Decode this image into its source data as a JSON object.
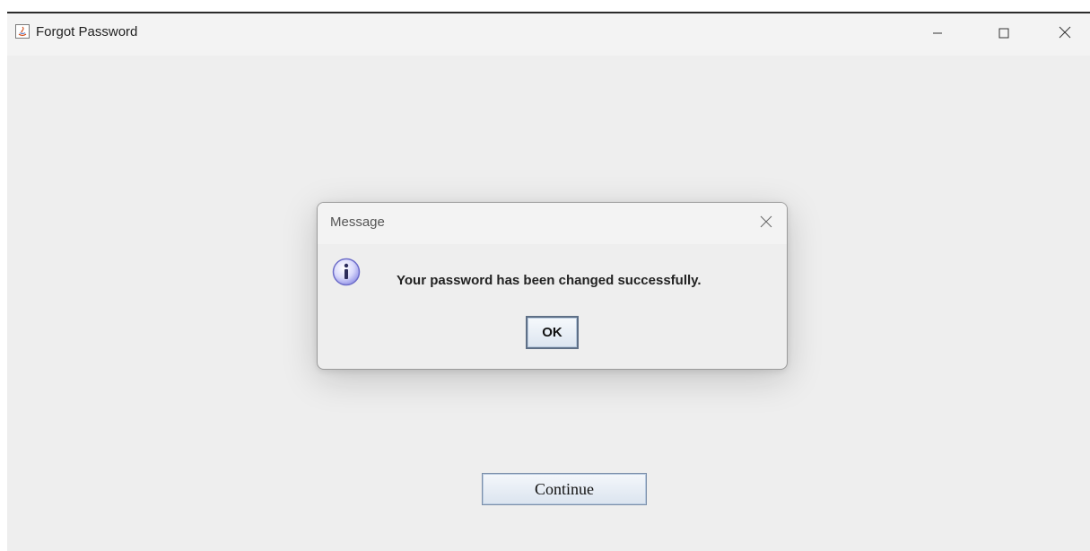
{
  "window": {
    "title": "Forgot Password",
    "icon": "java-app-icon",
    "controls": [
      "minimize-icon",
      "maximize-icon",
      "close-icon"
    ]
  },
  "main": {
    "continue_label": "Continue"
  },
  "dialog": {
    "title": "Message",
    "icon": "info-icon",
    "message": "Your password has been changed successfully.",
    "ok_label": "OK"
  },
  "colors": {
    "window_bg": "#eeeeee",
    "titlebar_bg": "#f3f3f3",
    "button_border": "#7a8ea8",
    "info_icon": "#8f8fe6"
  }
}
